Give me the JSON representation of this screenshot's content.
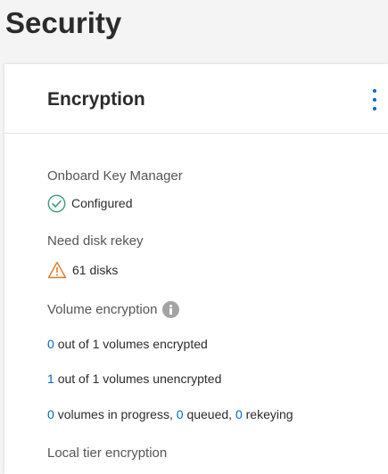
{
  "page": {
    "title": "Security"
  },
  "card": {
    "title": "Encryption",
    "menu_icon": "kebab-vertical-icon"
  },
  "onboard_key_manager": {
    "label": "Onboard Key Manager",
    "status": "Configured",
    "icon": "check-circle-icon",
    "color": "#3a9a7b"
  },
  "disk_rekey": {
    "label": "Need disk rekey",
    "value": "61 disks",
    "icon": "warning-triangle-icon",
    "color": "#e57a21"
  },
  "volume_encryption": {
    "label": "Volume encryption",
    "info_icon": "info-icon",
    "encrypted": {
      "count": "0",
      "text": "out of 1 volumes encrypted"
    },
    "unencrypted": {
      "count": "1",
      "text": "out of 1 volumes unencrypted"
    },
    "progress": {
      "in_progress_count": "0",
      "in_progress_text": "volumes in progress,",
      "queued_count": "0",
      "queued_text": "queued,",
      "rekeying_count": "0",
      "rekeying_text": "rekeying"
    }
  },
  "local_tier": {
    "label": "Local tier encryption"
  },
  "colors": {
    "link": "#0067c5",
    "background": "#f4f4f4"
  }
}
